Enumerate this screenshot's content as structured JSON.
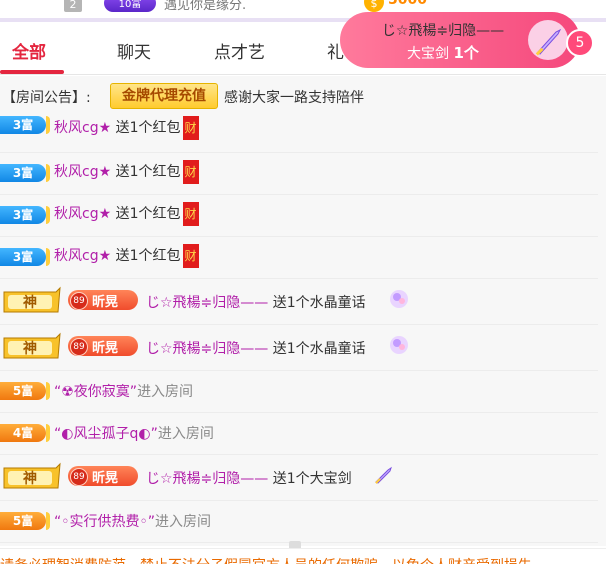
{
  "top": {
    "rank": "2",
    "level": "10富",
    "text": "遇见你是缘分.",
    "coins": "5000"
  },
  "tabs": [
    "全部",
    "聊天",
    "点才艺",
    "礼"
  ],
  "gift_popup": {
    "sender": "じ☆飛楊≑归隐——",
    "gift": "大宝剑",
    "count": "1个",
    "badge": "5"
  },
  "notice": {
    "label": "【房间公告】:",
    "button": "金牌代理充值",
    "message": "感谢大家一路支持陪伴"
  },
  "messages": [
    {
      "badge": "3富",
      "user": "秋风cg★",
      "action": "送1个红包",
      "icon": "财"
    },
    {
      "badge": "3富",
      "user": "秋风cg★",
      "action": "送1个红包",
      "icon": "财"
    },
    {
      "badge": "3富",
      "user": "秋风cg★",
      "action": "送1个红包",
      "icon": "财"
    },
    {
      "badge": "3富",
      "user": "秋风cg★",
      "action": "送1个红包",
      "icon": "财"
    },
    {
      "badge": "神",
      "level": "89",
      "title": "昕晃",
      "user": "じ☆飛楊≑归隐——",
      "action": "送1个水晶童话"
    },
    {
      "badge": "神",
      "level": "89",
      "title": "昕晃",
      "user": "じ☆飛楊≑归隐——",
      "action": "送1个水晶童话"
    },
    {
      "badge": "5富",
      "user": "“☢夜你寂寞”",
      "action": "进入房间"
    },
    {
      "badge": "4富",
      "user": "“◐风尘孤子q◐”",
      "action": "进入房间"
    },
    {
      "badge": "神",
      "level": "89",
      "title": "昕晃",
      "user": "じ☆飛楊≑归隐——",
      "action": "送1个大宝剑"
    },
    {
      "badge": "5富",
      "user": "“◦实行供热费◦”",
      "action": "进入房间"
    }
  ],
  "footer": {
    "text": "请务必理智消费防范，禁止不法分子假冒官方人员的任何欺骗，以免个人财产受到损失"
  },
  "colors": {
    "accent": "#e4263f",
    "username": "#b11fa9",
    "fu_blue": "#1187e5",
    "fu_orange": "#f0780f"
  }
}
